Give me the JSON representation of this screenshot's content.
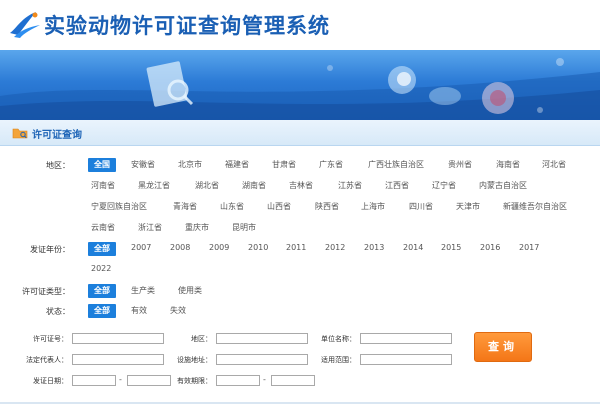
{
  "header": {
    "site_title": "实验动物许可证查询管理系统"
  },
  "section": {
    "title": "许可证查询"
  },
  "filters": {
    "region": {
      "label": "地区：",
      "options": [
        "全国",
        "安徽省",
        "北京市",
        "福建省",
        "甘肃省",
        "广东省",
        "广西壮族自治区",
        "贵州省",
        "海南省",
        "河北省",
        "河南省",
        "黑龙江省",
        "湖北省",
        "湖南省",
        "吉林省",
        "江苏省",
        "江西省",
        "辽宁省",
        "内蒙古自治区",
        "宁夏回族自治区",
        "青海省",
        "山东省",
        "山西省",
        "陕西省",
        "上海市",
        "四川省",
        "天津市",
        "新疆维吾尔自治区",
        "云南省",
        "浙江省",
        "重庆市",
        "昆明市"
      ],
      "selected": "全国"
    },
    "year": {
      "label": "发证年份：",
      "options": [
        "全部",
        "2007",
        "2008",
        "2009",
        "2010",
        "2011",
        "2012",
        "2013",
        "2014",
        "2015",
        "2016",
        "2017",
        "2022"
      ],
      "selected": "全部"
    },
    "license_type": {
      "label": "许可证类型：",
      "options": [
        "全部",
        "生产类",
        "使用类"
      ],
      "selected": "全部"
    },
    "status": {
      "label": "状态：",
      "options": [
        "全部",
        "有效",
        "失效"
      ],
      "selected": "全部"
    }
  },
  "form": {
    "license_no_label": "许可证号：",
    "region_label": "地区：",
    "unit_name_label": "单位名称：",
    "legal_rep_label": "法定代表人：",
    "facility_addr_label": "设施地址：",
    "scope_label": "适用范围：",
    "issue_date_label": "发证日期：",
    "valid_until_label": "有效期限：",
    "range_dash": "-",
    "license_no_value": "",
    "region_value": "",
    "unit_name_value": "",
    "legal_rep_value": "",
    "facility_addr_value": "",
    "scope_value": "",
    "issue_date_from": "",
    "issue_date_to": "",
    "valid_from": "",
    "valid_to": "",
    "search_label": "查询"
  },
  "colors": {
    "brand": "#1a5fb4",
    "selected_bg": "#1c7fdc",
    "button": "#f47617"
  }
}
